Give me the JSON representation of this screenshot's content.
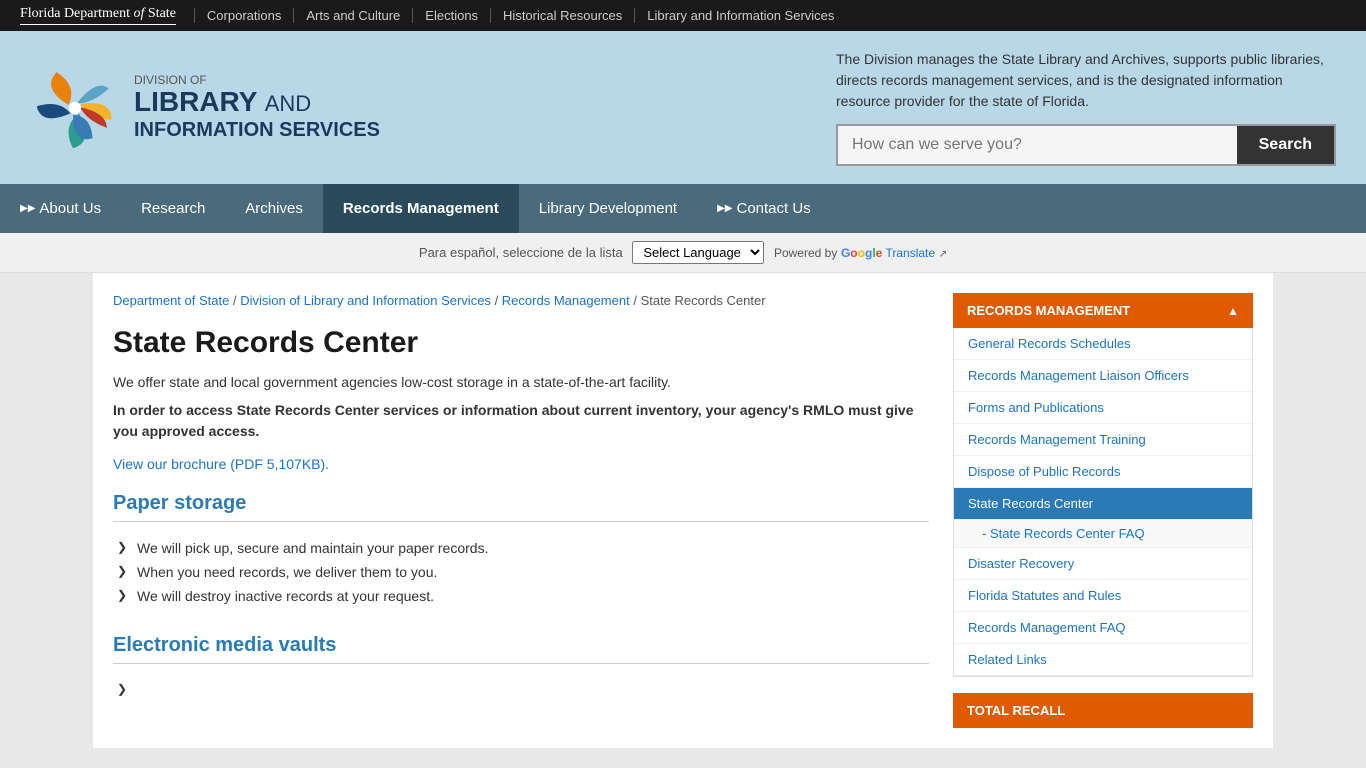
{
  "topbar": {
    "logo": "Florida Department of State",
    "logo_italic": "of",
    "nav_items": [
      "Corporations",
      "Arts and Culture",
      "Elections",
      "Historical Resources",
      "Library and Information Services"
    ]
  },
  "header": {
    "division_of": "DIVISION OF",
    "library_big": "LIBRARY",
    "and_text": "and",
    "info_services": "INFORMATION SERVICES",
    "description": "The Division manages the State Library and Archives, supports public libraries, directs records management services, and is the designated information resource provider for the state of Florida.",
    "search_placeholder": "How can we serve you?",
    "search_button": "Search"
  },
  "main_nav": {
    "items": [
      {
        "label": "About Us",
        "active": false,
        "has_arrow": true
      },
      {
        "label": "Research",
        "active": false,
        "has_arrow": false
      },
      {
        "label": "Archives",
        "active": false,
        "has_arrow": false
      },
      {
        "label": "Records Management",
        "active": true,
        "has_arrow": false
      },
      {
        "label": "Library Development",
        "active": false,
        "has_arrow": false
      },
      {
        "label": "Contact Us",
        "active": false,
        "has_arrow": true
      }
    ]
  },
  "lang_bar": {
    "text": "Para español, seleccione de la lista",
    "select_label": "Select Language",
    "powered_by": "Powered by",
    "google": "Google",
    "translate": "Translate"
  },
  "breadcrumb": {
    "items": [
      {
        "label": "Department of State",
        "href": "#"
      },
      {
        "label": "Division of Library and Information Services",
        "href": "#"
      },
      {
        "label": "Records Management",
        "href": "#"
      },
      {
        "label": "State Records Center",
        "href": null
      }
    ]
  },
  "page": {
    "title": "State Records Center",
    "intro": "We offer state and local government agencies low-cost storage in a state-of-the-art facility.",
    "access_notice": "In order to access State Records Center services or information about current inventory, your agency's RMLO must give you approved access.",
    "brochure_text": "View our brochure (PDF 5,107KB).",
    "paper_storage_title": "Paper storage",
    "paper_storage_items": [
      "We will pick up, secure and maintain your paper records.",
      "When you need records, we deliver them to you.",
      "We will destroy inactive records at your request."
    ],
    "electronic_title": "Electronic media vaults"
  },
  "sidebar": {
    "section_title": "RECORDS MANAGEMENT",
    "links": [
      {
        "label": "General Records Schedules",
        "active": false,
        "sub": false
      },
      {
        "label": "Records Management Liaison Officers",
        "active": false,
        "sub": false
      },
      {
        "label": "Forms and Publications",
        "active": false,
        "sub": false
      },
      {
        "label": "Records Management Training",
        "active": false,
        "sub": false
      },
      {
        "label": "Dispose of Public Records",
        "active": false,
        "sub": false
      },
      {
        "label": "State Records Center",
        "active": true,
        "sub": false
      },
      {
        "label": "State Records Center FAQ",
        "active": false,
        "sub": true
      },
      {
        "label": "Disaster Recovery",
        "active": false,
        "sub": false
      },
      {
        "label": "Florida Statutes and Rules",
        "active": false,
        "sub": false
      },
      {
        "label": "Records Management FAQ",
        "active": false,
        "sub": false
      },
      {
        "label": "Related Links",
        "active": false,
        "sub": false
      }
    ],
    "total_recall_title": "TOTAL RECALL"
  }
}
